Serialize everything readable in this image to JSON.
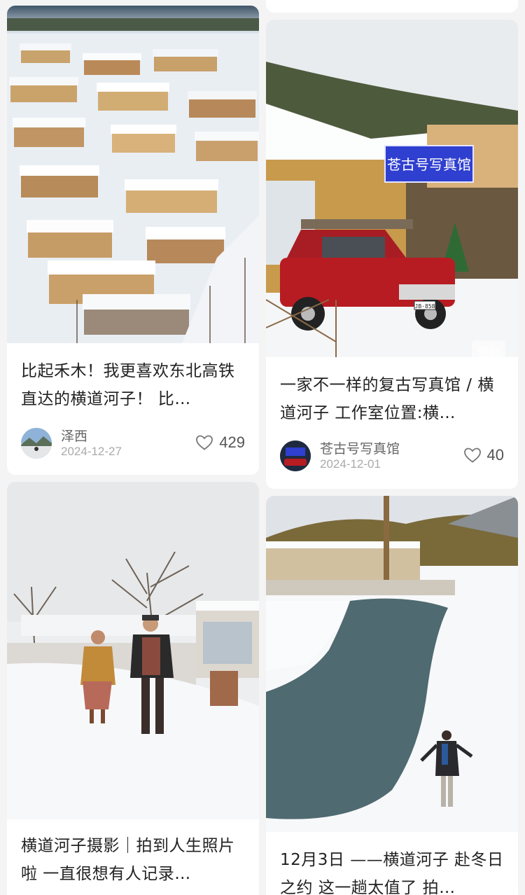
{
  "feed": {
    "left": [
      {
        "title": "比起禾木！我更喜欢东北高铁直达的横道河子！ 比…",
        "author": "泽西",
        "date": "2024-12-27",
        "likes": "429"
      },
      {
        "title": "横道河子摄影｜拍到人生照片啦 一直很想有人记录…"
      }
    ],
    "right": [
      {
        "title": "一家不一样的复古写真馆 / 横道河子 工作室位置:横…",
        "author": "苍古号写真馆",
        "date": "2024-12-01",
        "likes": "40",
        "sign_text": "苍古号写真馆",
        "plate_text": "JB·858",
        "sponsor_label": "赞助"
      },
      {
        "title": "12月3日 ——横道河子 赴冬日之约 这一趟太值了 拍…"
      }
    ]
  },
  "colors": {
    "background": "#f4f4f4",
    "card": "#ffffff",
    "title": "#222222",
    "meta": "#aaaaaa"
  },
  "icons": {
    "like": "heart-outline-icon"
  }
}
